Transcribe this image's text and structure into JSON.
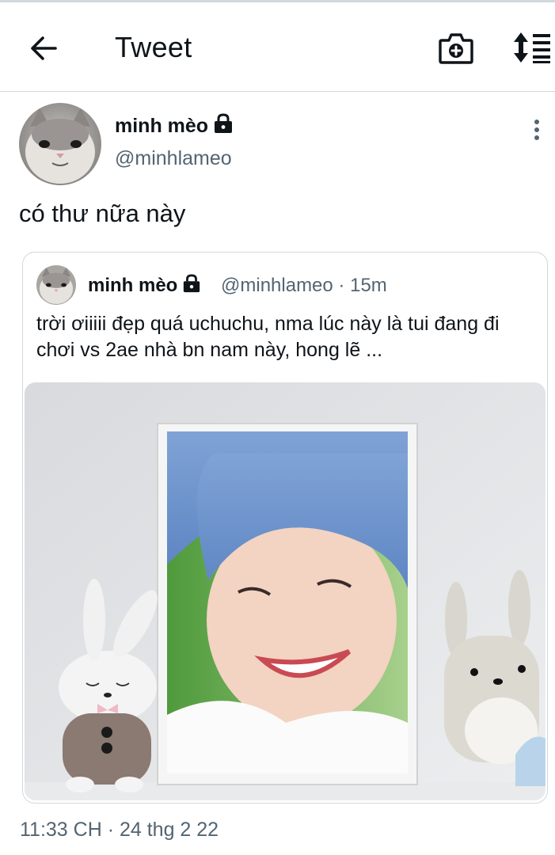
{
  "header": {
    "title": "Tweet",
    "back_icon": "arrow-left-icon",
    "camera_icon": "camera-plus-icon",
    "sort_icon": "sort-list-icon"
  },
  "tweet": {
    "author_name": "minh mèo",
    "author_handle": "@minhlameo",
    "text": "có thư nữa này",
    "timestamp": "11:33 CH · 24 thg 2 22",
    "more_icon": "more-vertical-icon",
    "lock_icon": "lock-icon"
  },
  "quoted": {
    "author_name": "minh mèo",
    "author_handle": "@minhlameo",
    "time": "15m",
    "separator": "·",
    "text": "trời ơiiiii đẹp quá uchuchu, nma lúc này là tui đang đi chơi vs 2ae nhà bn nam này, hong lẽ ...",
    "media": "photo-of-framed-portrait-with-plush-bunnies"
  },
  "colors": {
    "text_primary": "#0f1419",
    "text_secondary": "#536471",
    "border": "#cfd9de"
  }
}
